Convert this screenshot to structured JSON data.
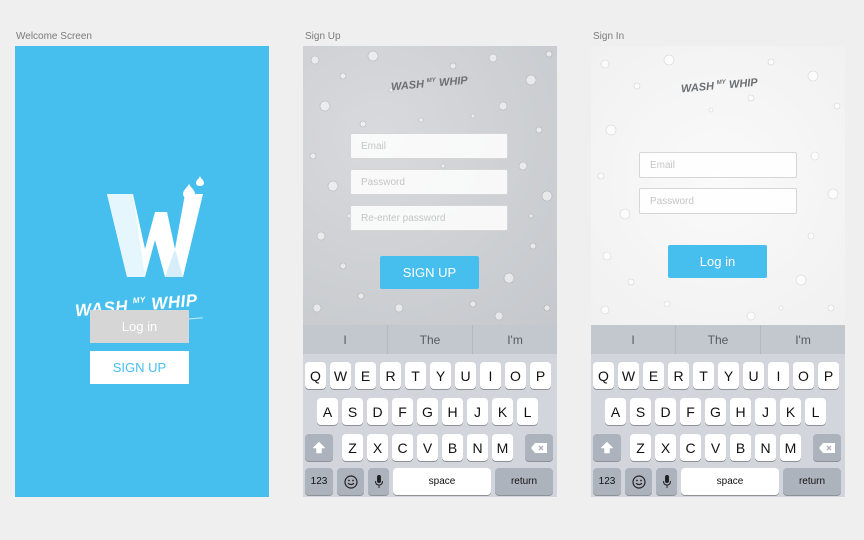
{
  "screens": {
    "welcome": {
      "label": "Welcome Screen",
      "brand": "WASH MY WHIP",
      "brand_word1": "WASH",
      "brand_word2": "MY",
      "brand_word3": "WHIP",
      "login_label": "Log in",
      "signup_label": "SIGN UP",
      "colors": {
        "background": "#47bfee",
        "login_bg": "#d6d6d6",
        "signup_text": "#47bfee"
      }
    },
    "signup": {
      "label": "Sign Up",
      "email_placeholder": "Email",
      "password_placeholder": "Password",
      "reenter_placeholder": "Re-enter password",
      "signup_label": "SIGN UP"
    },
    "signin": {
      "label": "Sign In",
      "email_placeholder": "Email",
      "password_placeholder": "Password",
      "login_label": "Log in"
    }
  },
  "keyboard": {
    "suggestions": [
      "I",
      "The",
      "I'm"
    ],
    "row1": [
      "Q",
      "W",
      "E",
      "R",
      "T",
      "Y",
      "U",
      "I",
      "O",
      "P"
    ],
    "row2": [
      "A",
      "S",
      "D",
      "F",
      "G",
      "H",
      "J",
      "K",
      "L"
    ],
    "row3": [
      "Z",
      "X",
      "C",
      "V",
      "B",
      "N",
      "M"
    ],
    "numbers_label": "123",
    "space_label": "space",
    "return_label": "return",
    "icons": [
      "shift-icon",
      "backspace-icon",
      "emoji-icon",
      "microphone-icon"
    ]
  },
  "colors": {
    "accent": "#47bfee",
    "keyboard_bg": "#d2d5db",
    "page_bg": "#efefef"
  }
}
